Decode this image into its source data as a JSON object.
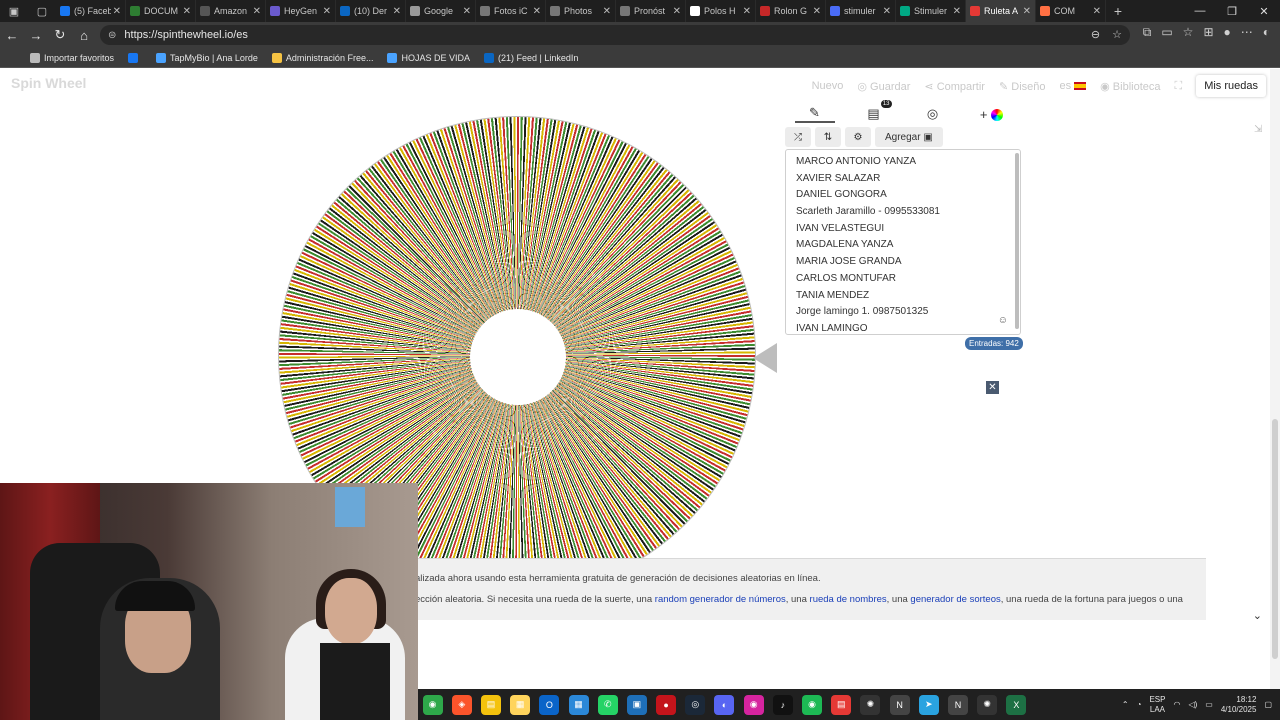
{
  "browser": {
    "tabs": [
      {
        "title": "(5) Faceb",
        "color": "#1877f2"
      },
      {
        "title": "DOCUM",
        "color": "#2e7d32"
      },
      {
        "title": "Amazon",
        "color": "#555555"
      },
      {
        "title": "HeyGen",
        "color": "#6a5acd"
      },
      {
        "title": "(10) Der",
        "color": "#0a66c2"
      },
      {
        "title": "Google",
        "color": "#999999"
      },
      {
        "title": "Fotos iC",
        "color": "#777777"
      },
      {
        "title": "Photos",
        "color": "#777777"
      },
      {
        "title": "Pronóst",
        "color": "#777777"
      },
      {
        "title": "Polos H",
        "color": "#ffffff"
      },
      {
        "title": "Rolon G",
        "color": "#c62828"
      },
      {
        "title": "stimuler",
        "color": "#4a6cf7"
      },
      {
        "title": "Stimuler",
        "color": "#00a884"
      },
      {
        "title": "Ruleta A",
        "color": "#e53935",
        "active": true
      },
      {
        "title": "COM",
        "color": "#ff7043"
      }
    ],
    "new_tab": "+",
    "url": "https://spinthewheel.io/es",
    "bookmarks": [
      {
        "label": "Importar favoritos",
        "color": "#bbbbbb"
      },
      {
        "label": "",
        "color": "#1877f2"
      },
      {
        "label": "TapMyBio | Ana Lorde",
        "color": "#4aa3ff"
      },
      {
        "label": "Administración Free...",
        "color": "#f6c343"
      },
      {
        "label": "HOJAS DE VIDA",
        "color": "#4aa3ff"
      },
      {
        "label": "(21) Feed | LinkedIn",
        "color": "#0a66c2"
      }
    ]
  },
  "app": {
    "logo": "Spin Wheel",
    "nav": {
      "nuevo": "Nuevo",
      "guardar": "Guardar",
      "compartir": "Compartir",
      "diseno": "Diseño",
      "idioma": "es",
      "biblioteca": "Biblioteca",
      "mis_ruedas": "Mis ruedas"
    },
    "panel": {
      "badge": "13",
      "add_label": "Agregar",
      "entries": [
        "MARCO ANTONIO YANZA",
        "XAVIER SALAZAR",
        "DANIEL GONGORA",
        "Scarleth Jaramillo - 0995533081",
        "IVAN VELASTEGUI",
        "MAGDALENA YANZA",
        "MARIA JOSE GRANDA",
        "CARLOS MONTUFAR",
        "TANIA MENDEZ",
        "Jorge lamingo 1. 0987501325",
        "IVAN LAMINGO"
      ],
      "count_label": "Entradas: 942"
    },
    "footer": {
      "line1": "alizada ahora usando esta herramienta gratuita de generación de decisiones aleatorias en línea.",
      "line2_a": "ección aleatoria. Si necesita una rueda de la suerte, una ",
      "link1": "random generador de números",
      "line2_b": ", una ",
      "link2": "rueda de nombres",
      "line2_c": ", una ",
      "link3": "generador de sorteos",
      "line2_d": ", una rueda de la fortuna para juegos o una"
    }
  },
  "taskbar": {
    "lang1": "ESP",
    "lang2": "LAA",
    "time": "18:12",
    "date": "4/10/2025"
  }
}
